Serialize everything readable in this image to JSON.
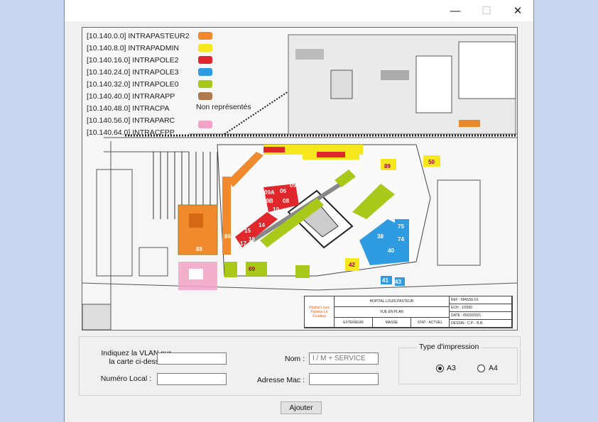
{
  "window": {
    "minimize_glyph": "—",
    "maximize_glyph": "☐",
    "close_glyph": "✕"
  },
  "map": {
    "legend": [
      {
        "label": "[10.140.0.0] INTRAPASTEUR2",
        "color": "#f08a2c"
      },
      {
        "label": "[10.140.8.0] INTRAPADMIN",
        "color": "#f5e71c"
      },
      {
        "label": "[10.140.16.0] INTRAPOLE2",
        "color": "#e0272c"
      },
      {
        "label": "[10.140.24.0] INTRAPOLE3",
        "color": "#2f9be0"
      },
      {
        "label": "[10.140.32.0] INTRAPOLE0",
        "color": "#a8c81a"
      },
      {
        "label": "[10.140.40.0] INTRARAPP",
        "color": "#b07a50"
      },
      {
        "label": "[10.140.48.0] INTRACPA",
        "color": ""
      },
      {
        "label": "[10.140.56.0] INTRAPARC",
        "color": ""
      },
      {
        "label": "[10.140.64.0] INTRACFPP",
        "color": "#f2a3c6"
      }
    ],
    "non_represented": "Non représentés",
    "building_labels": {
      "b88": "88",
      "b09a": "09A",
      "b09b": "09B",
      "b10": "10",
      "b08": "08",
      "b06": "06",
      "b05": "05",
      "b15": "15",
      "b14": "14",
      "b16": "16",
      "b17": "17",
      "b86": "86",
      "b89": "89",
      "b50": "50",
      "b42": "42",
      "b40": "40",
      "b38": "38",
      "b75": "75",
      "b74": "74",
      "b41": "41",
      "b43": "43",
      "b69": "69"
    },
    "title_block": {
      "hospital": "HOPITAL LOUIS PASTEUR",
      "view": "VUE EN PLAN",
      "exterior": "EXTERIEUR",
      "masse": "MASSE",
      "stat": "STAT : ACTUEL",
      "ref": "REF : MASSE.01",
      "scale": "ECH : 1/2000",
      "date": "DATE : 05/03/2021",
      "design": "DESSIN : C.P. - B.B.",
      "logo_text": "Hôpital Louis Pasteur Le Coudray"
    }
  },
  "form": {
    "vlan_label": "Indiquez la VLAN sur\nla carte ci-dessus :",
    "vlan_value": "",
    "local_label": "Numéro Local :",
    "local_value": "",
    "nom_label": "Nom :",
    "nom_placeholder": "I / M + SERVICE",
    "mac_label": "Adresse Mac :",
    "mac_value": "",
    "print_type_title": "Type d'impression",
    "option_a3": "A3",
    "option_a4": "A4",
    "selected_option": "A3",
    "submit_label": "Ajouter"
  }
}
